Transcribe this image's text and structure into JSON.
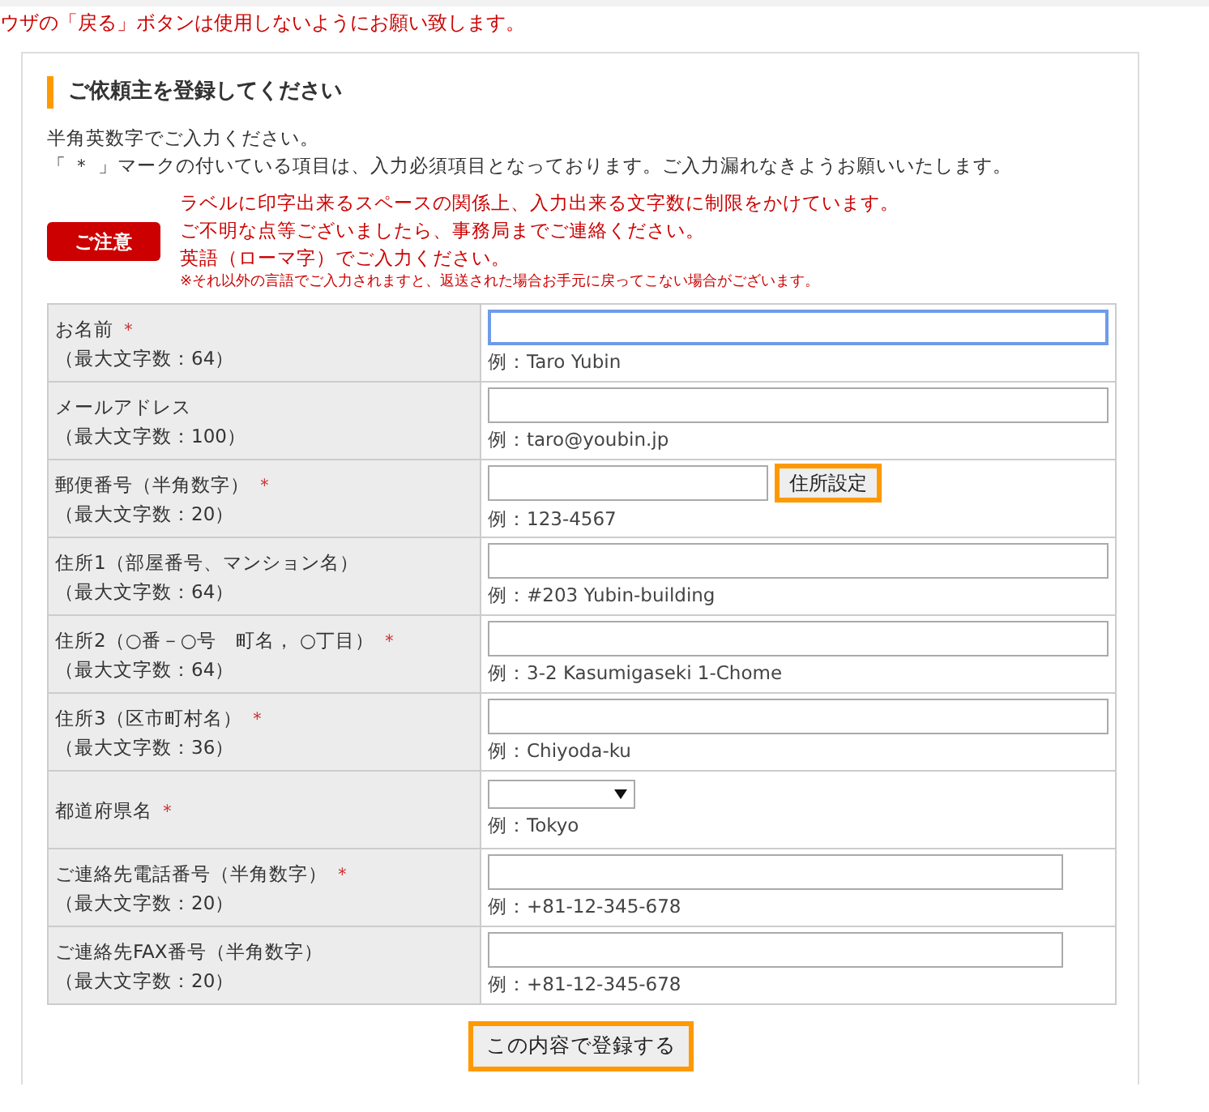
{
  "notice": "ウザの「戻る」ボタンは使用しないようにお願い致します。",
  "panel": {
    "heading": "ご依頼主を登録してください",
    "intro": [
      "半角英数字でご入力ください。",
      "「 ＊ 」マークの付いている項目は、入力必須項目となっております。ご入力漏れなきようお願いいたします。"
    ],
    "caution": {
      "badge": "ご注意",
      "lines": [
        "ラベルに印字出来るスペースの関係上、入力出来る文字数に制限をかけています。",
        "ご不明な点等ございましたら、事務局までご連絡ください。",
        "英語（ローマ字）でご入力ください。"
      ],
      "note": "※それ以外の言語でご入力されますと、返送された場合お手元に戻ってこない場合がございます。"
    },
    "fields": [
      {
        "label": "お名前",
        "mark": "＊",
        "limit": "（最大文字数：64）",
        "kind": "text",
        "focused": true,
        "example": "例：Taro Yubin"
      },
      {
        "label": "メールアドレス",
        "limit": "（最大文字数：100）",
        "kind": "text",
        "focused": false,
        "example": "例：taro@youbin.jp"
      },
      {
        "label": "郵便番号（半角数字）",
        "mark": "＊",
        "limit": "（最大文字数：20）",
        "kind": "postal",
        "focused": false,
        "button": "住所設定",
        "example": "例：123-4567"
      },
      {
        "label": "住所1（部屋番号、マンション名）",
        "limit": "（最大文字数：64）",
        "kind": "text",
        "focused": false,
        "example": "例：#203 Yubin-building"
      },
      {
        "label": "住所2（○番－○号　町名，  ○丁目）",
        "mark": "＊",
        "limit": "（最大文字数：64）",
        "kind": "text",
        "focused": false,
        "example": "例：3-2 Kasumigaseki 1-Chome"
      },
      {
        "label": "住所3（区市町村名）",
        "mark": "＊",
        "limit": "（最大文字数：36）",
        "kind": "text",
        "focused": false,
        "example": "例：Chiyoda-ku"
      },
      {
        "label": "都道府県名",
        "mark": "＊",
        "kind": "select",
        "example": "例：Tokyo"
      },
      {
        "label": "ご連絡先電話番号（半角数字）",
        "mark": "＊",
        "limit": "（最大文字数：20）",
        "kind": "phone",
        "focused": false,
        "example": "例：+81-12-345-678"
      },
      {
        "label": "ご連絡先FAX番号（半角数字）",
        "limit": "（最大文字数：20）",
        "kind": "phone",
        "focused": false,
        "example": "例：+81-12-345-678"
      }
    ],
    "submit": "この内容で登録する"
  }
}
